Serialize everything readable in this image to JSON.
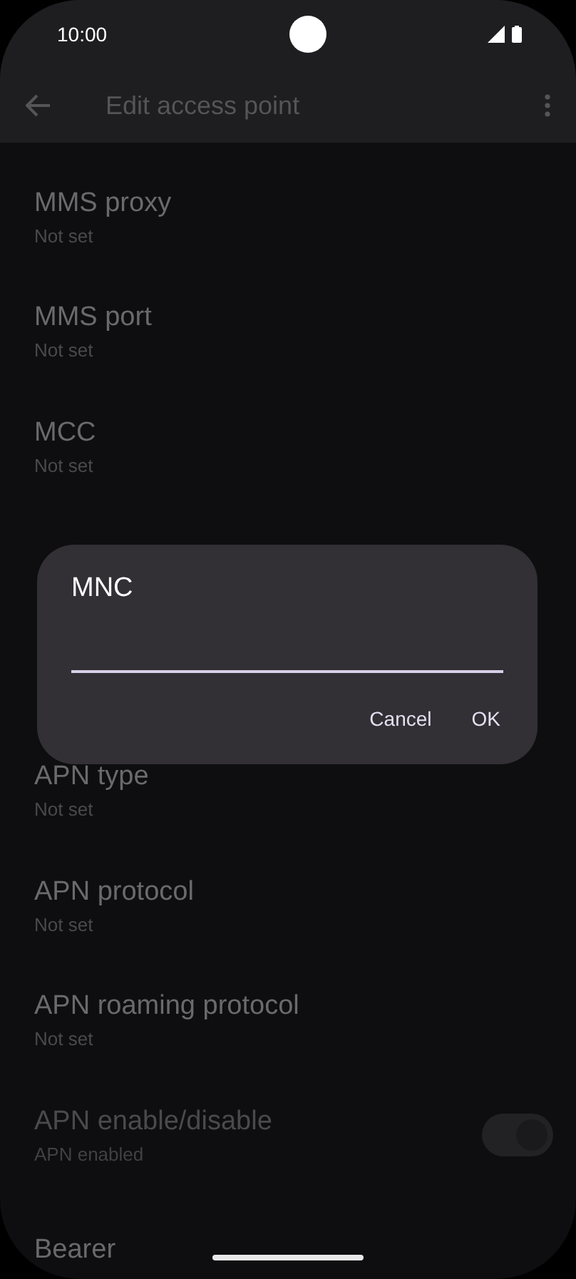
{
  "status_bar": {
    "time": "10:00"
  },
  "app_bar": {
    "title": "Edit access point"
  },
  "settings": [
    {
      "kind": "text",
      "title": "MMS proxy",
      "summary": "Not set"
    },
    {
      "kind": "text",
      "title": "MMS port",
      "summary": "Not set"
    },
    {
      "kind": "text",
      "title": "MCC",
      "summary": "Not set"
    },
    {
      "kind": "hidden"
    },
    {
      "kind": "hidden"
    },
    {
      "kind": "text",
      "title": "APN type",
      "summary": "Not set"
    },
    {
      "kind": "text",
      "title": "APN protocol",
      "summary": "Not set"
    },
    {
      "kind": "text",
      "title": "APN roaming protocol",
      "summary": "Not set"
    },
    {
      "kind": "switch",
      "title": "APN enable/disable",
      "summary": "APN enabled",
      "disabled": true,
      "on": true
    },
    {
      "kind": "text",
      "title": "Bearer"
    }
  ],
  "dialog": {
    "title": "MNC",
    "buttons": [
      "Cancel",
      "OK"
    ]
  }
}
